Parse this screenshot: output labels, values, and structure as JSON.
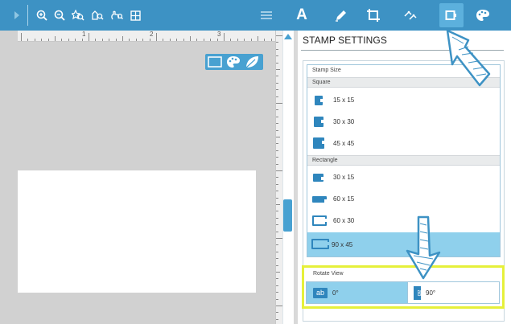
{
  "toolbar": {
    "left_tools": [
      "zoom-in-icon",
      "zoom-out-icon",
      "zoom-fit-icon",
      "zoom-selection-icon",
      "pan-icon",
      "grid-icon"
    ],
    "right_tools": [
      "align-icon",
      "text-icon",
      "pencil-icon",
      "crop-icon",
      "edit-points-icon",
      "stamp-settings-icon",
      "palette-icon"
    ],
    "text_tool_label": "A",
    "accent": "#3d92c4",
    "active_bg": "#5cb0dd"
  },
  "ruler": {
    "labels": [
      "1",
      "2",
      "3"
    ]
  },
  "canvas_icons": [
    "rectangle-icon",
    "palette-icon",
    "leaf-icon"
  ],
  "panel": {
    "title": "STAMP SETTINGS",
    "stamp_size": {
      "label": "Stamp Size",
      "square_label": "Square",
      "square_options": [
        "15 x 15",
        "30 x 30",
        "45 x 45"
      ],
      "rectangle_label": "Rectangle",
      "rectangle_options": [
        "30 x 15",
        "60 x 15",
        "60 x 30",
        "90 x 45"
      ],
      "selected": "90 x 45"
    },
    "rotate_view": {
      "label": "Rotate View",
      "options": [
        "0°",
        "90°"
      ],
      "icon_text": "ab",
      "selected": "0°"
    },
    "highlight_color": "#e6f03a",
    "selection_color": "#8fd0ec"
  }
}
